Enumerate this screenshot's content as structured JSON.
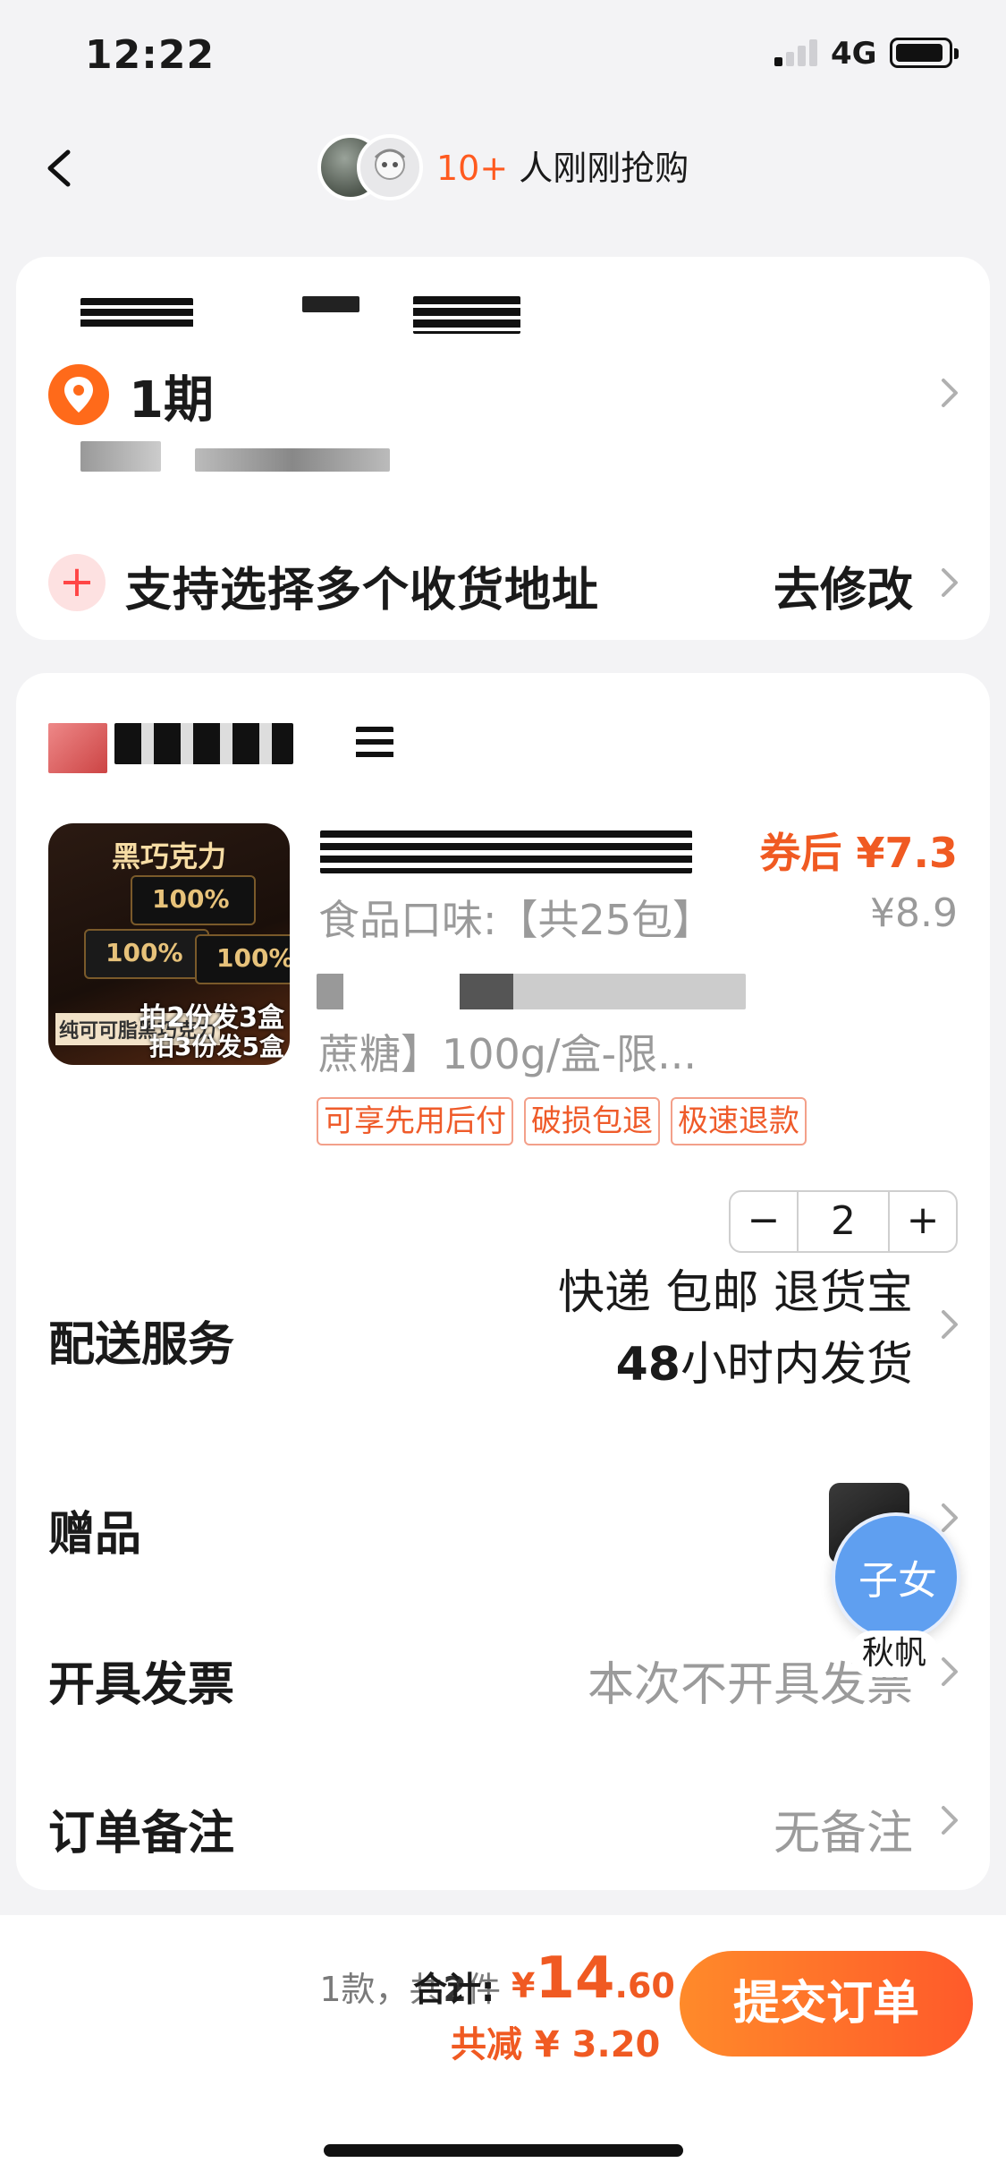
{
  "status_bar": {
    "time": "12:22",
    "network": "4G"
  },
  "nav": {
    "buyer_count": "10+",
    "buyer_text": " 人刚刚抢购"
  },
  "address": {
    "title": "1期",
    "multi_label": "支持选择多个收货地址",
    "modify_label": "去修改"
  },
  "product": {
    "image_text": {
      "title": "黑巧克力",
      "pct": "100%",
      "corner": "纯可可脂黑巧克力",
      "promo1": "拍2份发3盒",
      "promo2": "拍3份发5盒"
    },
    "coupon_price": "券后 ¥7.3",
    "original_price": "¥8.9",
    "spec_line1": "食品口味:【共25包】",
    "spec_line2": "蔗糖】100g/盒-限...",
    "tags": [
      "可享先用后付",
      "破损包退",
      "极速退款"
    ],
    "quantity": "2"
  },
  "rows": {
    "delivery": {
      "label": "配送服务",
      "line1": "快递 包邮 退货宝",
      "line2_num": "48",
      "line2_text": "小时内发货"
    },
    "gift": {
      "label": "赠品"
    },
    "invoice": {
      "label": "开具发票",
      "value": "本次不开具发票"
    },
    "remark": {
      "label": "订单备注",
      "value": "无备注"
    }
  },
  "floating": {
    "badge": "子女",
    "name": "秋帆"
  },
  "footer": {
    "count_prefix": "1款，共",
    "count_num": "2",
    "count_suffix": "件",
    "total_label": "合计:",
    "total_currency": "¥",
    "total_int": "14",
    "total_dec": ".60",
    "saved": "共减 ¥ 3.20",
    "submit": "提交订单"
  },
  "colors": {
    "accent": "#f05a22",
    "submit_start": "#ff8a2a",
    "submit_end": "#ff5a2a",
    "float_badge": "#5f9ff0"
  }
}
